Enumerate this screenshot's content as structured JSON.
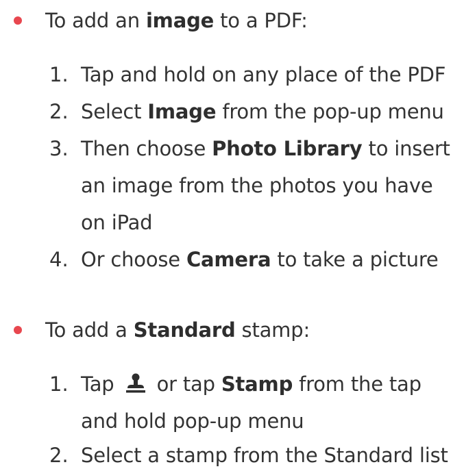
{
  "section1": {
    "intro_pre": "To add an ",
    "intro_bold": "image",
    "intro_post": " to a PDF:",
    "step1_num": "1.",
    "step1_text": "Tap and hold on any place of the PDF",
    "step2_num": "2.",
    "step2_pre": "Select ",
    "step2_bold": "Image",
    "step2_post": " from the pop-up menu",
    "step3_num": "3.",
    "step3_pre": "Then choose ",
    "step3_bold": "Photo Library",
    "step3_post": " to insert",
    "step3_line2": "an image from the photos you have",
    "step3_line3": "on iPad",
    "step4_num": "4.",
    "step4_pre": "Or choose ",
    "step4_bold": "Camera",
    "step4_post": " to take a picture"
  },
  "section2": {
    "intro_pre": "To add a ",
    "intro_bold": "Standard",
    "intro_post": " stamp:",
    "step1_num": "1.",
    "step1_pre": "Tap",
    "step1_icon": "stamp-icon",
    "step1_mid": "or tap ",
    "step1_bold": "Stamp",
    "step1_post": " from the tap",
    "step1_line2": "and hold pop-up menu",
    "step2_num": "2.",
    "step2_text": "Select a stamp from the Standard list"
  },
  "colors": {
    "bullet": "#e8474f",
    "text": "#333333"
  }
}
